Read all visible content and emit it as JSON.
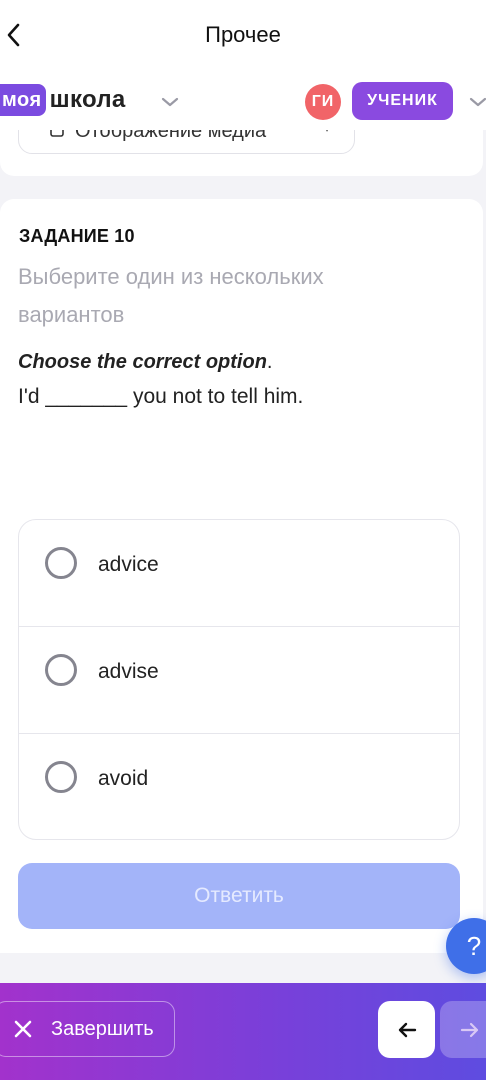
{
  "header": {
    "title": "Прочее"
  },
  "school": {
    "logo_part1": "моя",
    "logo_part2": "школа"
  },
  "user": {
    "initials": "ГИ",
    "role": "УЧЕНИК"
  },
  "previous_card": {
    "media_select_label": "Отображение медиа"
  },
  "task": {
    "label": "ЗАДАНИЕ 10",
    "instruction": "Выберите один из нескольких вариантов",
    "prompt": "Choose the correct option",
    "prompt_punct": ".",
    "question": "I'd _______ you not to tell him.",
    "options": [
      {
        "label": "advice"
      },
      {
        "label": "advise"
      },
      {
        "label": "avoid"
      }
    ],
    "answer_button": "Ответить"
  },
  "help": {
    "label": "?"
  },
  "bottom": {
    "finish_label": "Завершить"
  },
  "colors": {
    "brand_purple": "#7b4be0",
    "avatar_red": "#f16468",
    "role_badge": "#8a4ae0",
    "answer_disabled": "#a3b4f9",
    "help_blue": "#3f6fe8",
    "bottom_gradient_start": "#a232cc",
    "bottom_gradient_end": "#5e4ce0"
  }
}
